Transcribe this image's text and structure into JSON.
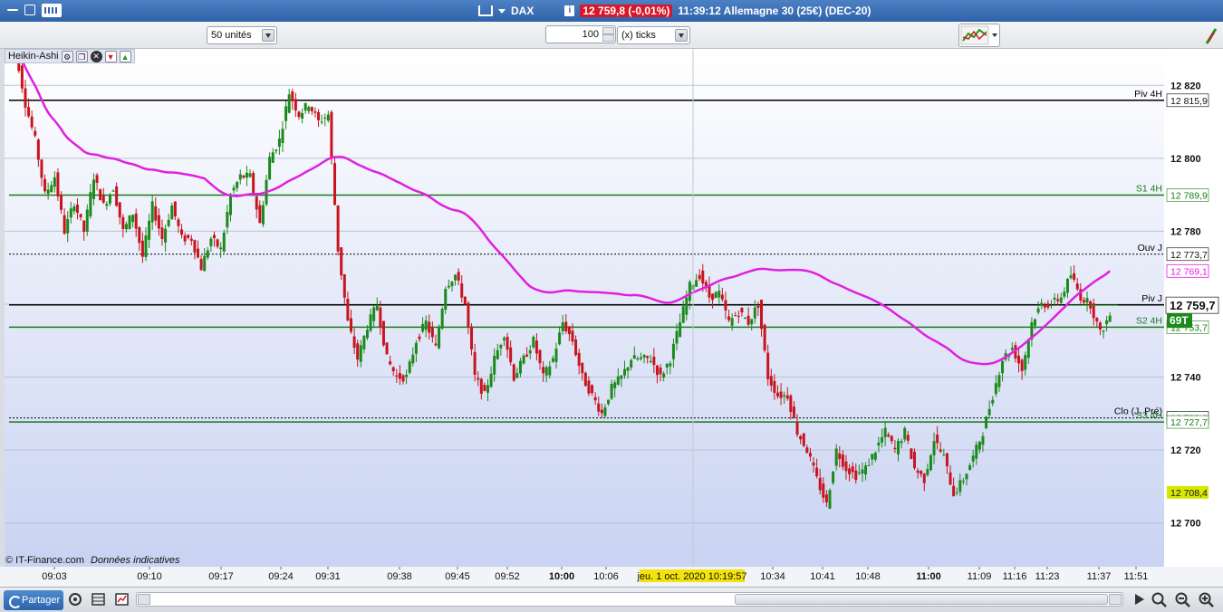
{
  "titlebar": {
    "symbol": "DAX",
    "price_badge": "12 759,8 (-0,01%)",
    "time_label": "11:39:12 Allemagne 30 (25€) (DEC-20)"
  },
  "toolbar": {
    "units_select": "50 unités",
    "period_value": "100",
    "period_unit": "(x) ticks"
  },
  "indicator": {
    "name": "Heikin-Ashi"
  },
  "footer": {
    "copyright": "© IT-Finance.com",
    "disclaimer": "Données indicatives",
    "share_label": "Partager"
  },
  "chart_data": {
    "type": "candlestick",
    "style": "Heikin-Ashi",
    "ylim": [
      12688,
      12830
    ],
    "y_ticks": [
      12700,
      12720,
      12740,
      12760,
      12780,
      12800,
      12820
    ],
    "y_tick_labels": [
      "12 700",
      "12 720",
      "12 740",
      "12 760",
      "12 780",
      "12 800",
      "12 820"
    ],
    "x_ticks": [
      {
        "label": "09:03",
        "bold": false
      },
      {
        "label": "09:10",
        "bold": false
      },
      {
        "label": "09:17",
        "bold": false
      },
      {
        "label": "09:24",
        "bold": false
      },
      {
        "label": "09:31",
        "bold": false
      },
      {
        "label": "09:38",
        "bold": false
      },
      {
        "label": "09:45",
        "bold": false
      },
      {
        "label": "09:52",
        "bold": false
      },
      {
        "label": "10:00",
        "bold": true
      },
      {
        "label": "10:06",
        "bold": false
      },
      {
        "label": "10:34",
        "bold": false
      },
      {
        "label": "10:41",
        "bold": false
      },
      {
        "label": "10:48",
        "bold": false
      },
      {
        "label": "11:00",
        "bold": true
      },
      {
        "label": "11:09",
        "bold": false
      },
      {
        "label": "11:16",
        "bold": false
      },
      {
        "label": "11:23",
        "bold": false
      },
      {
        "label": "11:37",
        "bold": false
      },
      {
        "label": "11:51",
        "bold": false
      }
    ],
    "crosshair_label": "jeu. 1 oct. 2020 10:19:57",
    "levels": [
      {
        "name": "Piv 4H",
        "value": 12815.9,
        "label": "12 815,9",
        "color": "#000000",
        "style": "solid"
      },
      {
        "name": "S1 4H",
        "value": 12789.9,
        "label": "12 789,9",
        "color": "#1a7a1a",
        "style": "solid"
      },
      {
        "name": "Ouv J",
        "value": 12773.7,
        "label": "12 773,7",
        "color": "#000000",
        "style": "dotted"
      },
      {
        "name": "Piv J",
        "value": 12759.8,
        "label": "12 759,8",
        "color": "#000000",
        "style": "solid"
      },
      {
        "name": "S2 4H",
        "value": 12753.7,
        "label": "12 753,7",
        "color": "#1a7a1a",
        "style": "solid"
      },
      {
        "name": "Clo (J. Pré)",
        "value": 12728.8,
        "label": "12 728,8",
        "color": "#000000",
        "style": "dotted"
      },
      {
        "name": "S3 4H",
        "value": 12727.7,
        "label": "12 727,7",
        "color": "#1a7a1a",
        "style": "solid"
      }
    ],
    "moving_average": {
      "label": "12 769,1",
      "color": "#e020e0",
      "last": 12769.1
    },
    "extra_label": {
      "label": "12 708,4",
      "value": 12708.4,
      "color": "#d6e800"
    },
    "last_price": {
      "label": "12 759,7",
      "value": 12759.7,
      "volume_label": "69T"
    },
    "close_path": [
      12830,
      12815,
      12805,
      12790,
      12795,
      12780,
      12788,
      12780,
      12795,
      12787,
      12792,
      12780,
      12785,
      12773,
      12787,
      12778,
      12787,
      12778,
      12778,
      12770,
      12778,
      12775,
      12790,
      12795,
      12795,
      12782,
      12800,
      12805,
      12818,
      12812,
      12815,
      12810,
      12812,
      12775,
      12755,
      12745,
      12754,
      12760,
      12745,
      12740,
      12740,
      12750,
      12755,
      12748,
      12765,
      12768,
      12760,
      12740,
      12735,
      12745,
      12752,
      12740,
      12745,
      12750,
      12740,
      12745,
      12755,
      12750,
      12740,
      12735,
      12730,
      12737,
      12740,
      12745,
      12745,
      12745,
      12740,
      12745,
      12755,
      12765,
      12768,
      12762,
      12763,
      12755,
      12758,
      12755,
      12760,
      12740,
      12735,
      12735,
      12725,
      12720,
      12712,
      12705,
      12720,
      12715,
      12713,
      12715,
      12720,
      12725,
      12720,
      12725,
      12715,
      12712,
      12723,
      12718,
      12708,
      12712,
      12718,
      12725,
      12735,
      12745,
      12748,
      12742,
      12755,
      12760,
      12760,
      12762,
      12768,
      12762,
      12760,
      12752,
      12757
    ]
  }
}
